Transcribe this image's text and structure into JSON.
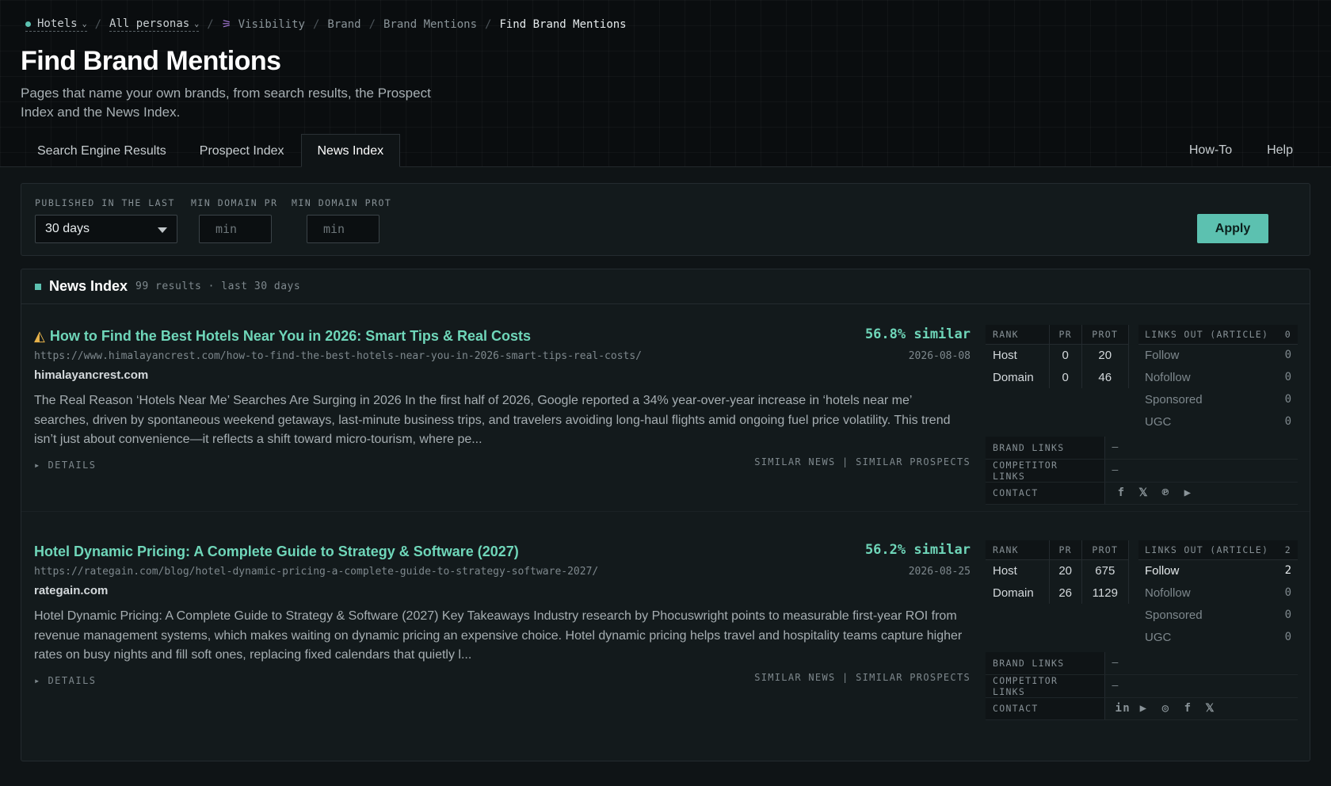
{
  "breadcrumb": {
    "project": "Hotels",
    "persona": "All personas",
    "items": [
      "Visibility",
      "Brand",
      "Brand Mentions"
    ],
    "current": "Find Brand Mentions"
  },
  "page": {
    "title": "Find Brand Mentions",
    "subtitle": "Pages that name your own brands, from search results, the Prospect Index and the News Index."
  },
  "tabs": [
    "Search Engine Results",
    "Prospect Index",
    "News Index"
  ],
  "active_tab": "News Index",
  "right_tabs": [
    "How-To",
    "Help"
  ],
  "filters": {
    "published_label": "PUBLISHED IN THE LAST",
    "published_value": "30 days",
    "min_pr_label": "MIN DOMAIN PR",
    "min_pr_placeholder": "min",
    "min_prot_label": "MIN DOMAIN PROT",
    "min_prot_placeholder": "min",
    "apply_label": "Apply"
  },
  "results": {
    "title": "News Index",
    "meta": "99 results · last 30 days",
    "labels": {
      "rank": "RANK",
      "pr": "PR",
      "prot": "PROT",
      "host": "Host",
      "domain": "Domain",
      "links_out": "LINKS OUT (ARTICLE)",
      "follow": "Follow",
      "nofollow": "Nofollow",
      "sponsored": "Sponsored",
      "ugc": "UGC",
      "brand_links": "BRAND LINKS",
      "competitor_links": "COMPETITOR LINKS",
      "contact": "CONTACT",
      "details": "▸ DETAILS",
      "similar_links": "SIMILAR NEWS | SIMILAR PROSPECTS"
    },
    "items": [
      {
        "title": "How to Find the Best Hotels Near You in 2026: Smart Tips & Real Costs",
        "url": "https://www.himalayancrest.com/how-to-find-the-best-hotels-near-you-in-2026-smart-tips-real-costs/",
        "domain": "himalayancrest.com",
        "snippet": "The Real Reason ‘Hotels Near Me’ Searches Are Surging in 2026 In the first half of 2026, Google reported a 34% year-over-year increase in ‘hotels near me’ searches, driven by spontaneous weekend getaways, last-minute business trips, and travelers avoiding long-haul flights amid ongoing fuel price volatility. This trend isn’t just about convenience—it reflects a shift toward micro-tourism, where pe...",
        "similar": "56.8% similar",
        "date": "2026-08-08",
        "host_pr": "0",
        "host_prot": "20",
        "domain_pr": "0",
        "domain_prot": "46",
        "links_total": "0",
        "follow": "0",
        "nofollow": "0",
        "sponsored": "0",
        "ugc": "0",
        "brand_links": "–",
        "competitor_links": "–",
        "contacts": [
          "facebook-icon",
          "x-icon",
          "pinterest-icon",
          "youtube-icon"
        ]
      },
      {
        "title": "Hotel Dynamic Pricing: A Complete Guide to Strategy & Software (2027)",
        "url": "https://rategain.com/blog/hotel-dynamic-pricing-a-complete-guide-to-strategy-software-2027/",
        "domain": "rategain.com",
        "snippet": "Hotel Dynamic Pricing: A Complete Guide to Strategy & Software (2027) Key Takeaways Industry research by Phocuswright points to measurable first-year ROI from revenue management systems, which makes waiting on dynamic pricing an expensive choice. Hotel dynamic pricing helps travel and hospitality teams capture higher rates on busy nights and fill soft ones, replacing fixed calendars that quietly l...",
        "similar": "56.2% similar",
        "date": "2026-08-25",
        "host_pr": "20",
        "host_prot": "675",
        "domain_pr": "26",
        "domain_prot": "1129",
        "links_total": "2",
        "follow": "2",
        "nofollow": "0",
        "sponsored": "0",
        "ugc": "0",
        "brand_links": "–",
        "competitor_links": "–",
        "contacts": [
          "linkedin-icon",
          "youtube-icon",
          "instagram-icon",
          "facebook-icon",
          "x-icon"
        ]
      }
    ]
  }
}
